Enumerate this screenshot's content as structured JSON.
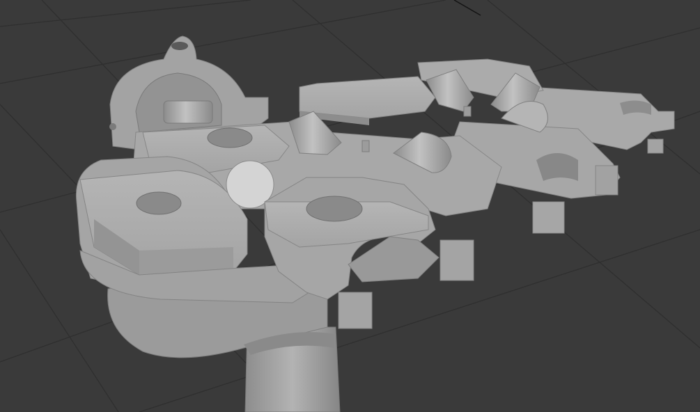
{
  "viewport": {
    "background": "#3a3a3a",
    "grid_color": "#2e2e2e",
    "shading": "solid"
  },
  "model": {
    "base_color": "#a9a9a9",
    "light_color": "#c4c4c4",
    "dark_color": "#7f7f7f",
    "hole_color": "#8a8a8a",
    "parts": [
      "mounting-bracket",
      "spur-gear",
      "base-plate",
      "cam-arm-front-left",
      "cam-arm-front-center",
      "cam-arm-rear-left",
      "cam-arm-rear-center",
      "cam-arm-right",
      "cylinder-pegs",
      "support-column",
      "disc-marker"
    ]
  }
}
